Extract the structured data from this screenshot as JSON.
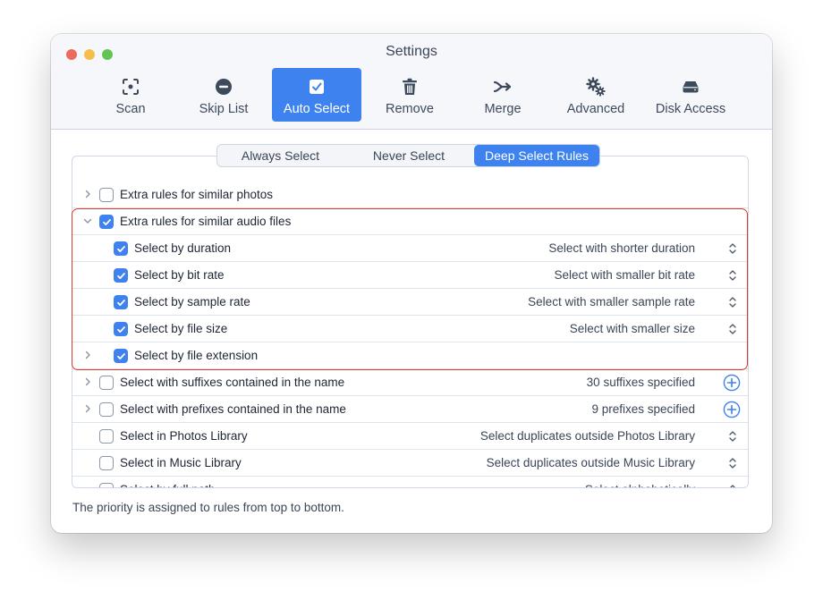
{
  "window": {
    "title": "Settings"
  },
  "toolbar": [
    {
      "key": "scan",
      "label": "Scan",
      "icon": "scan-icon",
      "active": false
    },
    {
      "key": "skip-list",
      "label": "Skip List",
      "icon": "minus-circle-icon",
      "active": false
    },
    {
      "key": "auto-select",
      "label": "Auto Select",
      "icon": "checkbox-icon",
      "active": true
    },
    {
      "key": "remove",
      "label": "Remove",
      "icon": "trash-icon",
      "active": false
    },
    {
      "key": "merge",
      "label": "Merge",
      "icon": "merge-arrow-icon",
      "active": false
    },
    {
      "key": "advanced",
      "label": "Advanced",
      "icon": "gears-icon",
      "active": false
    },
    {
      "key": "disk-access",
      "label": "Disk Access",
      "icon": "drive-icon",
      "active": false
    }
  ],
  "segments": [
    {
      "label": "Always Select",
      "selected": false
    },
    {
      "label": "Never Select",
      "selected": false
    },
    {
      "label": "Deep Select Rules",
      "selected": true
    }
  ],
  "rules": [
    {
      "label": "Extra rules for similar photos",
      "checked": false,
      "chevron": "right",
      "indent": 0,
      "value": "",
      "control": "none"
    },
    {
      "label": "Extra rules for similar audio files",
      "checked": true,
      "chevron": "down",
      "indent": 0,
      "value": "",
      "control": "none"
    },
    {
      "label": "Select by duration",
      "checked": true,
      "chevron": "none",
      "indent": 1,
      "value": "Select with shorter duration",
      "control": "stepper"
    },
    {
      "label": "Select by bit rate",
      "checked": true,
      "chevron": "none",
      "indent": 1,
      "value": "Select with smaller bit rate",
      "control": "stepper"
    },
    {
      "label": "Select by sample rate",
      "checked": true,
      "chevron": "none",
      "indent": 1,
      "value": "Select with smaller sample rate",
      "control": "stepper"
    },
    {
      "label": "Select by file size",
      "checked": true,
      "chevron": "none",
      "indent": 1,
      "value": "Select with smaller size",
      "control": "stepper"
    },
    {
      "label": "Select by file extension",
      "checked": true,
      "chevron": "right",
      "indent": 1,
      "value": "",
      "control": "none"
    },
    {
      "label": "Select with suffixes contained in the name",
      "checked": false,
      "chevron": "right",
      "indent": 0,
      "value": "30 suffixes specified",
      "control": "plus"
    },
    {
      "label": "Select with prefixes contained in the name",
      "checked": false,
      "chevron": "right",
      "indent": 0,
      "value": "9 prefixes specified",
      "control": "plus"
    },
    {
      "label": "Select in Photos Library",
      "checked": false,
      "chevron": "none",
      "indent": 0,
      "value": "Select duplicates outside Photos Library",
      "control": "stepper"
    },
    {
      "label": "Select in Music Library",
      "checked": false,
      "chevron": "none",
      "indent": 0,
      "value": "Select duplicates outside Music Library",
      "control": "stepper"
    },
    {
      "label": "Select by full path",
      "checked": false,
      "chevron": "none",
      "indent": 0,
      "value": "Select alphabetically",
      "control": "stepper"
    }
  ],
  "footer": {
    "text": "The priority is assigned to rules from top to bottom."
  },
  "colors": {
    "accent": "#3e82ef",
    "highlight_border": "#e0392d"
  }
}
